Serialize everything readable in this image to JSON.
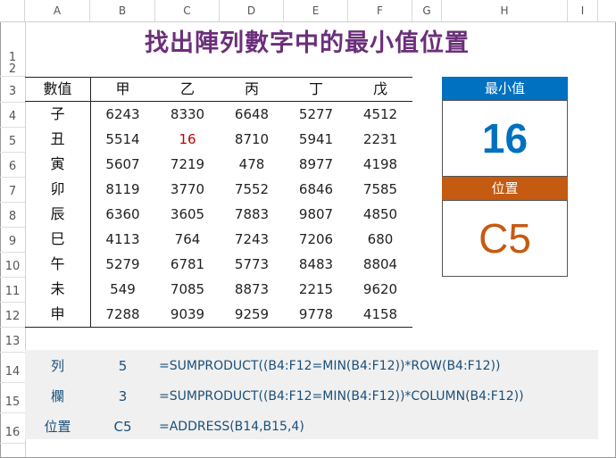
{
  "columns": [
    "A",
    "B",
    "C",
    "D",
    "E",
    "F",
    "G",
    "H",
    "I"
  ],
  "rows": [
    "1",
    "2",
    "3",
    "4",
    "5",
    "6",
    "7",
    "8",
    "9",
    "10",
    "11",
    "12",
    "13",
    "14",
    "15",
    "16"
  ],
  "title": "找出陣列數字中的最小值位置",
  "table": {
    "corner": "數值",
    "headers": [
      "甲",
      "乙",
      "丙",
      "丁",
      "戊"
    ],
    "row_labels": [
      "子",
      "丑",
      "寅",
      "卯",
      "辰",
      "巳",
      "午",
      "未",
      "申"
    ],
    "values": [
      [
        "6243",
        "8330",
        "6648",
        "5277",
        "4512"
      ],
      [
        "5514",
        "16",
        "8710",
        "5941",
        "2231"
      ],
      [
        "5607",
        "7219",
        "478",
        "8977",
        "4198"
      ],
      [
        "8119",
        "3770",
        "7552",
        "6846",
        "7585"
      ],
      [
        "6360",
        "3605",
        "7883",
        "9807",
        "4850"
      ],
      [
        "4113",
        "764",
        "7243",
        "7206",
        "680"
      ],
      [
        "5279",
        "6781",
        "5773",
        "8483",
        "8804"
      ],
      [
        "549",
        "7085",
        "8873",
        "2215",
        "9620"
      ],
      [
        "7288",
        "9039",
        "9259",
        "9778",
        "4158"
      ]
    ],
    "highlight_color": "#c00000"
  },
  "min_box": {
    "label": "最小值",
    "value": "16",
    "header_color": "#0070c0"
  },
  "pos_box": {
    "label": "位置",
    "value": "C5",
    "header_color": "#c55a11"
  },
  "formulas": [
    {
      "label": "列",
      "value": "5",
      "formula": "=SUMPRODUCT((B4:F12=MIN(B4:F12))*ROW(B4:F12))"
    },
    {
      "label": "欄",
      "value": "3",
      "formula": "=SUMPRODUCT((B4:F12=MIN(B4:F12))*COLUMN(B4:F12))"
    },
    {
      "label": "位置",
      "value": "C5",
      "formula": "=ADDRESS(B14,B15,4)"
    }
  ]
}
